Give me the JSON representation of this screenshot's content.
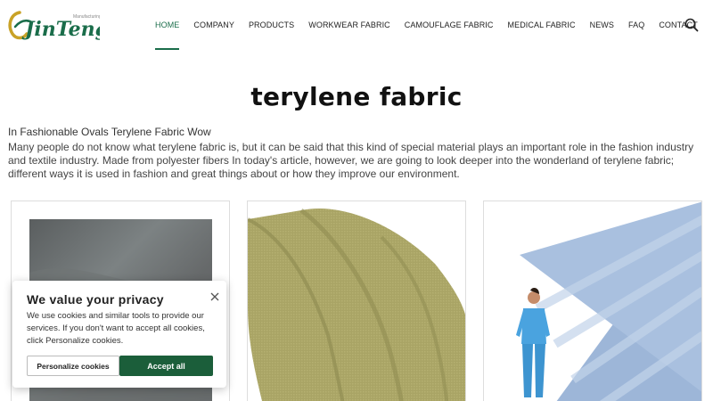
{
  "brand": {
    "logo_text": "JinTeng",
    "logo_tagline": "Manufacturing",
    "brand_color": "#1a6d4a",
    "accent_color": "#c9a227"
  },
  "nav": {
    "items": [
      {
        "label": "HOME",
        "active": true
      },
      {
        "label": "COMPANY",
        "active": false
      },
      {
        "label": "PRODUCTS",
        "active": false
      },
      {
        "label": "WORKWEAR FABRIC",
        "active": false
      },
      {
        "label": "CAMOUFLAGE FABRIC",
        "active": false
      },
      {
        "label": "MEDICAL FABRIC",
        "active": false
      },
      {
        "label": "NEWS",
        "active": false
      },
      {
        "label": "FAQ",
        "active": false
      },
      {
        "label": "CONTACT",
        "active": false
      }
    ],
    "search_icon": "search-icon"
  },
  "page": {
    "title": "terylene fabric",
    "subtitle": "In Fashionable Ovals Terylene Fabric Wow",
    "intro": "Many people do not know what terylene fabric is, but it can be said that this kind of special material plays an important role in the fashion industry and textile industry. Made from polyester fibers In today's article, however, we are going to look deeper into the wonderland of terylene fabric; different ways it is used in fashion and great things about or how they improve our environment."
  },
  "products": [
    {
      "image": "grey-fabric-image"
    },
    {
      "image": "khaki-fabric-image"
    },
    {
      "image": "medical-scrubs-fabric-image"
    }
  ],
  "cookie": {
    "title": "We value your privacy",
    "text": "We use cookies and similar tools to provide our services. If you don't want to accept all cookies, click Personalize cookies.",
    "personalize_label": "Personalize cookies",
    "accept_label": "Accept all",
    "accept_color": "#1b5e3a"
  }
}
